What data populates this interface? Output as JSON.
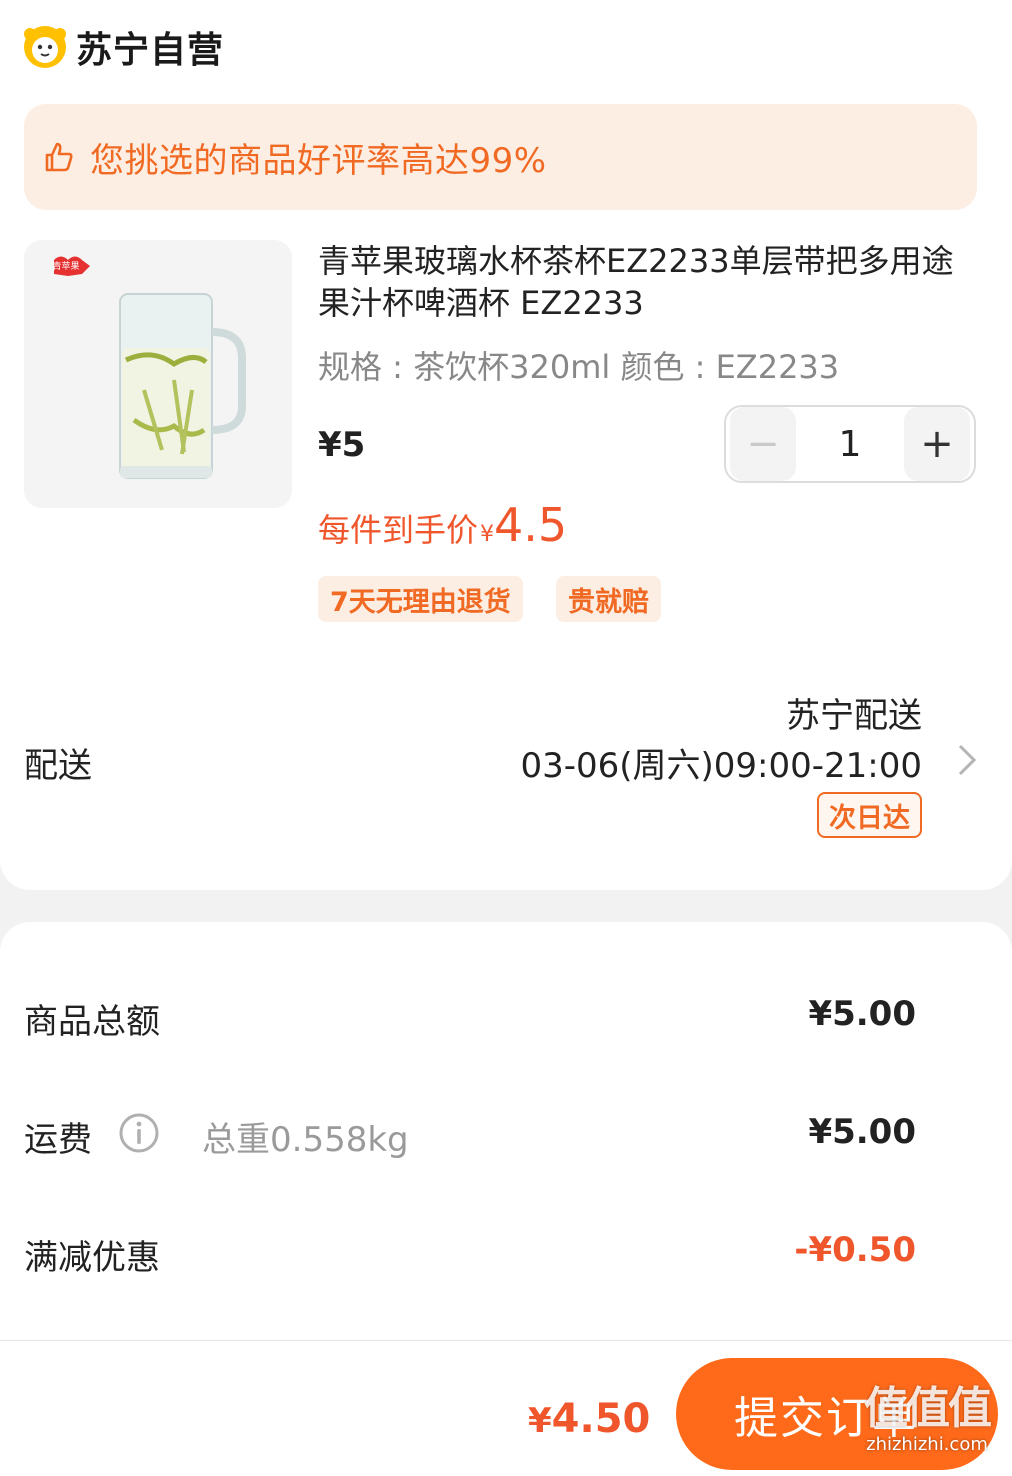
{
  "store": {
    "name": "苏宁自营",
    "logo_icon": "suning-lion-logo-icon"
  },
  "banner": {
    "icon": "thumbs-up-icon",
    "text": "您挑选的商品好评率高达99%"
  },
  "product": {
    "image_brand": "青苹果",
    "title": "青苹果玻璃水杯茶杯EZ2233单层带把多用途果汁杯啤酒杯 EZ2233",
    "spec": "规格 : 茶饮杯320ml  颜色 : EZ2233",
    "price": "¥5",
    "quantity": "1",
    "minus_label": "−",
    "plus_label": "+",
    "unit_price_label": "每件到手价",
    "unit_price_yen": "¥",
    "unit_price_value": "4.5",
    "tags": [
      "7天无理由退货",
      "贵就赔"
    ]
  },
  "delivery": {
    "label": "配送",
    "provider": "苏宁配送",
    "time": "03-06(周六)09:00-21:00",
    "badge": "次日达"
  },
  "summary": {
    "goods_total_label": "商品总额",
    "goods_total_value": "¥5.00",
    "shipping_label": "运费",
    "shipping_weight": "总重0.558kg",
    "shipping_value": "¥5.00",
    "discount_label": "满减优惠",
    "discount_value": "-¥0.50"
  },
  "footer": {
    "total_yen": "¥",
    "total_value": "4.50",
    "submit_label": "提交订单"
  },
  "watermark": {
    "main": "值值值",
    "sub": "zhizhizhi.com"
  },
  "colors": {
    "accent": "#f0562c",
    "orange": "#ff6a1a",
    "banner_bg": "#fdeee3"
  }
}
